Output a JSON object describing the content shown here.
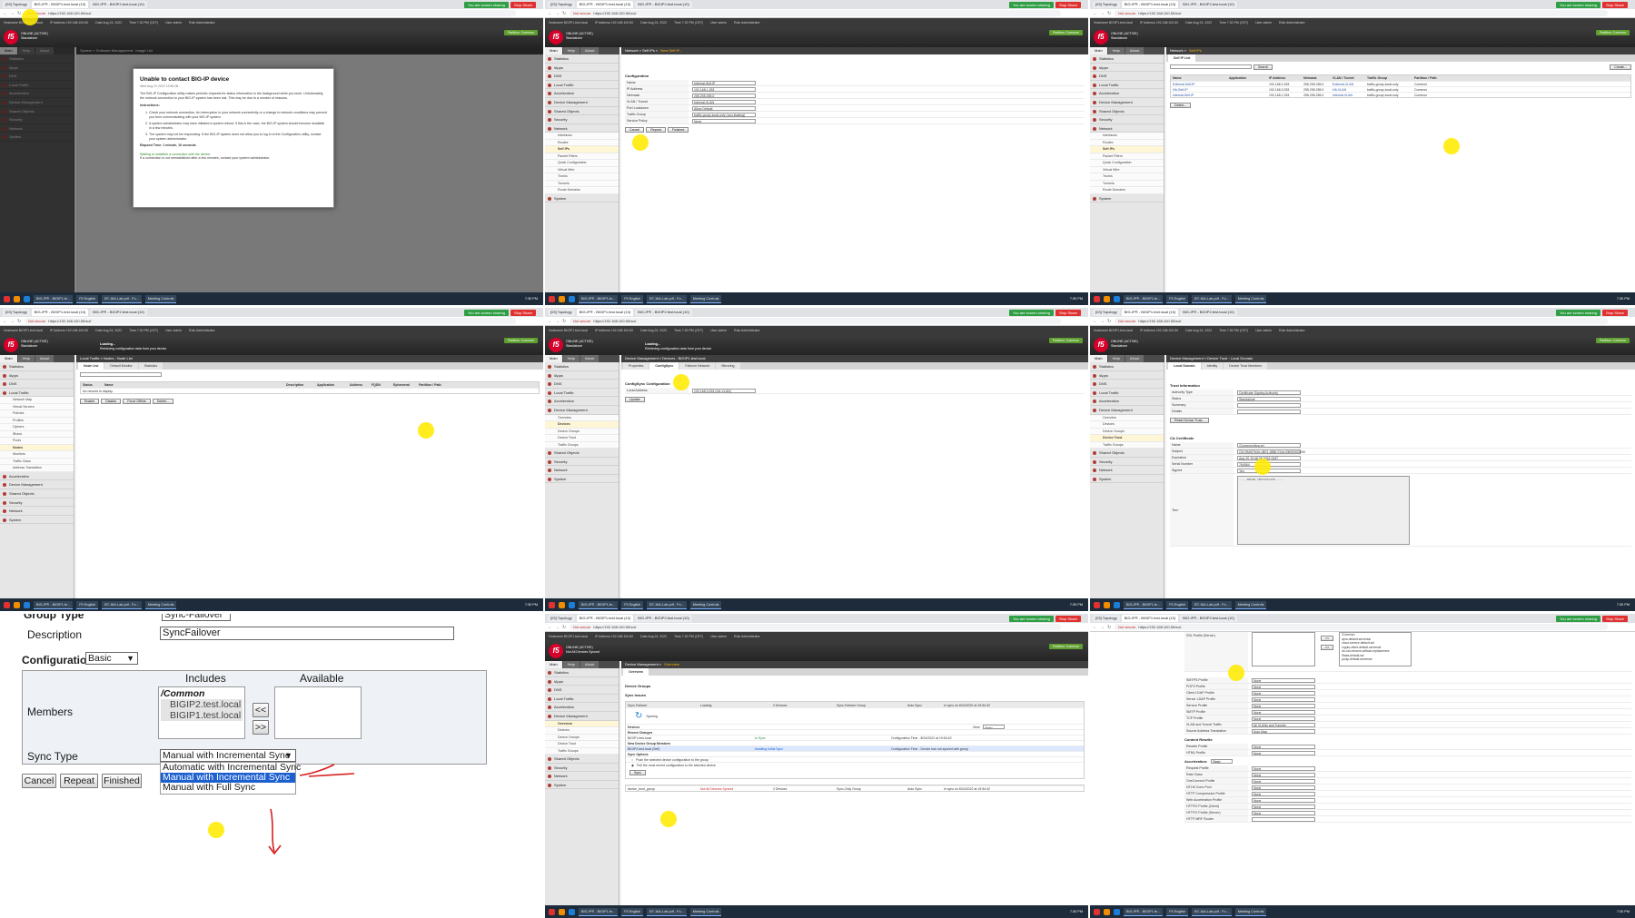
{
  "common": {
    "tabs": [
      "[03] Topology",
      "BIG-IP® - BIGIP1.test.local (10)",
      "BIG-IP® - BIGIP2.test.local (10)"
    ],
    "sharing_text": "You are screen sharing",
    "stop_share": "Stop Share",
    "not_secure": "Not secure",
    "url": "https://192.168.100.50/xui/",
    "f5_logo": "f5",
    "status_online": "ONLINE (ACTIVE)",
    "status_mode": "Standalone",
    "status_mode_sync": "Not All Devices Synced",
    "taskbar_apps": [
      "BIG-IP® - BIGIP1.te...",
      "F5 English",
      "BT-16A-Lab.pdf - Fo...",
      "Meeting Controls"
    ],
    "clock": "7:30 PM",
    "header_info": [
      "Hostname BIGIP1.test.local",
      "IP Address 192.168.100.50",
      "Date Aug 24, 2022",
      "Time 7:30 PM (CET)",
      "User admin",
      "Role Administrator"
    ],
    "partition_label": "Partition: Common",
    "log_out": "Log out",
    "nav_tabs": [
      "Main",
      "Help",
      "About"
    ],
    "nav_items": [
      "Statistics",
      "iApps",
      "DNS",
      "Local Traffic",
      "Acceleration",
      "Device Management",
      "Shared Objects",
      "Security",
      "Network",
      "System"
    ]
  },
  "panel1": {
    "breadcrumb": "System » Software Management : Image List",
    "dialog_title": "Unable to contact BIG-IP device",
    "dialog_date": "Wed Aug 24 2022 19:50:08",
    "dialog_intro": "The BIG-IP Configuration utility makes periodic requests for status information in the background while you work. Unfortunately, the network connection to your BIG-IP system has been lost. This may be due to a number of reasons.",
    "instructions_label": "Instructions:",
    "items": [
      "Check your network connection. An interruption in your network connectivity or a change to network conditions may prevent you from communicating with your BIG-IP system.",
      "A system administrator may have initiated a system reboot. If this is the case, the BIG-IP system should become available in a few minutes.",
      "The system may not be responding. If the BIG-IP system does not allow you to log in to the Configuration utility, contact your system administrator."
    ],
    "elapsed": "Elapsed Time: 1 minute, 10 seconds",
    "waiting": "Waiting to establish a connection with the device.",
    "waiting2": "If a connection is not reestablished after a few minutes, contact your system administrator."
  },
  "panel2": {
    "breadcrumb_a": "Network » Self IPs »",
    "breadcrumb_b": "New Self IP...",
    "section": "Configuration",
    "rows": [
      {
        "label": "Name",
        "value": "Internal-Self-IP"
      },
      {
        "label": "IP Address",
        "value": "192.168.1.253"
      },
      {
        "label": "Netmask",
        "value": "255.255.255.0"
      },
      {
        "label": "VLAN / Tunnel",
        "value": "Internal-VLAN"
      },
      {
        "label": "Port Lockdown",
        "value": "Allow Default"
      },
      {
        "label": "Traffic Group",
        "value": "traffic-group-local-only (non-floating)"
      },
      {
        "label": "Service Policy",
        "value": "None"
      }
    ],
    "buttons": [
      "Cancel",
      "Repeat",
      "Finished"
    ],
    "sub_items": [
      "Interfaces",
      "Routes",
      "Self IPs",
      "Packet Filters",
      "Quick Configuration",
      "Virtual Wire",
      "Trunks",
      "Tunnels",
      "Route Domains"
    ]
  },
  "panel3": {
    "breadcrumb_a": "Network »",
    "breadcrumb_b": "Self IPs",
    "subtab": "Self IP List",
    "search_btn": "Search",
    "create_btn": "Create...",
    "columns": [
      "Name",
      "Application",
      "IP Address",
      "Netmask",
      "VLAN / Tunnel",
      "Traffic Group",
      "Partition / Path"
    ],
    "rows": [
      [
        "External-Self-IP",
        "",
        "192.168.2.253",
        "255.255.255.0",
        "External-VLAN",
        "traffic-group-local-only",
        "Common"
      ],
      [
        "HA-Self-IP",
        "",
        "192.168.3.253",
        "255.255.255.0",
        "HA-VLAN",
        "traffic-group-local-only",
        "Common"
      ],
      [
        "Internal-Self-IP",
        "",
        "192.168.1.253",
        "255.255.255.0",
        "Internal-VLAN",
        "traffic-group-local-only",
        "Common"
      ]
    ],
    "delete_btn": "Delete..."
  },
  "panel4": {
    "loading": "Loading...",
    "loading_sub": "Retrieving configuration data from your device",
    "breadcrumb": "Local Traffic » Nodes : Node List",
    "subtabs": [
      "Node List",
      "Default Monitor",
      "Statistics"
    ],
    "columns": [
      "Status",
      "Name",
      "Description",
      "Application",
      "Address",
      "FQDN",
      "Ephemeral",
      "Partition / Path"
    ],
    "empty": "No records to display.",
    "buttons": [
      "Enable",
      "Disable",
      "Force Offline",
      "Delete..."
    ],
    "sub_items": [
      "Network Map",
      "Virtual Servers",
      "Policies",
      "Profiles",
      "Ciphers",
      "iRules",
      "Pools",
      "Nodes",
      "Monitors",
      "Traffic Class",
      "Address Translation"
    ]
  },
  "panel5": {
    "loading": "Loading...",
    "loading_sub": "Retrieving configuration data from your device",
    "breadcrumb": "Device Management » Devices : BIGIP1.test.local",
    "subtabs": [
      "Properties",
      "ConfigSync",
      "Failover Network",
      "Mirroring"
    ],
    "section": "ConfigSync Configuration",
    "label": "Local Address",
    "value": "192.168.3.253 (HA-VLAN)",
    "update_btn": "Update",
    "sub_items": [
      "Overview",
      "Devices",
      "Device Groups",
      "Device Trust",
      "Traffic Groups"
    ]
  },
  "panel6": {
    "breadcrumb": "Device Management » Device Trust : Local Domain",
    "subtabs": [
      "Local Domain",
      "Identity",
      "Device Trust Members"
    ],
    "section1": "Trust Information",
    "rows1": [
      {
        "label": "Authority Type",
        "value": "Certificate Signing Authority"
      },
      {
        "label": "Status",
        "value": "Standalone"
      },
      {
        "label": "Summary",
        "value": ""
      },
      {
        "label": "Details",
        "value": ""
      }
    ],
    "reset_btn": "Reset Device Trust...",
    "section2": "CA Certificate",
    "rows2": [
      {
        "label": "Name",
        "value": "/Common/dtca.crt"
      },
      {
        "label": "Subject",
        "value": "CN=9fd0f7fc2e-d501-4886-97a4-f0f000000000"
      },
      {
        "label": "Expiration",
        "value": "Aug 20 19:48:38 2032 GMT"
      },
      {
        "label": "Serial Number",
        "value": "764064"
      },
      {
        "label": "Signed",
        "value": "Yes"
      }
    ],
    "text_label": "Text",
    "cert_header": "-----BEGIN CERTIFICATE-----"
  },
  "panel7": {
    "group_type_label": "Group Type",
    "group_type_value": "Sync-Failover",
    "description_label": "Description",
    "description_value": "SyncFailover",
    "configuration_label": "Configuration:",
    "configuration_value": "Basic",
    "includes_label": "Includes",
    "available_label": "Available",
    "members_label": "Members",
    "includes_items": [
      "/Common",
      "BIGIP2.test.local",
      "BIGIP1.test.local"
    ],
    "move_left": "<<",
    "move_right": ">>",
    "sync_type_label": "Sync Type",
    "sync_type_value": "Manual with Incremental Sync",
    "sync_options": [
      "Automatic with Incremental Sync",
      "Manual with Incremental Sync",
      "Manual with Full Sync"
    ],
    "buttons": [
      "Cancel",
      "Repeat",
      "Finished"
    ]
  },
  "panel8": {
    "breadcrumb_a": "Device Management »",
    "breadcrumb_b": "Overview",
    "subtab": "Overview",
    "section": "Device Groups",
    "sync_issues": "Sync Issues",
    "group_row": [
      "Sync-Failover",
      "Loading",
      "2 Devices",
      "Sync-Failover Group",
      "Auto Sync",
      "In sync on 8/24/2022 at 19:54:42"
    ],
    "syncing": "Syncing",
    "devices_label": "Devices",
    "view_label": "View:",
    "view_value": "Basic",
    "recent_changes": "Recent Changes",
    "device1": [
      "BIGIP1.test.local",
      "In Sync",
      "Configuration Time - 8/24/2022 at 19:54:42"
    ],
    "new_members": "New Device Group Members",
    "device2": [
      "BIGIP2.test.local (Self)",
      "Awaiting Initial Sync",
      "Configuration Time - Device has not synced with group"
    ],
    "sync_options": "Sync Options",
    "opt1": "Push the selected device configuration to the group",
    "opt2": "Pull the most recent configuration to the selected device",
    "sync_btn": "Sync",
    "trust_row": [
      "device_trust_group",
      "Not All Devices Synced",
      "2 Devices",
      "Sync-Only Group",
      "Auto Sync",
      "In sync on 8/24/2022 at 19:54:42"
    ]
  },
  "panel9": {
    "ssl_server_label": "SSL Profile (Server)",
    "list_items": [
      "/Common",
      "apm-default-serverssl",
      "cloud-service-default-ssl",
      "crypto-client-default-serverssl",
      "do-not-remove-without-replacement",
      "f5aas-default-ssl",
      "pcoip-default-serverssl"
    ],
    "rows": [
      {
        "label": "SMTPS Profile",
        "value": "None"
      },
      {
        "label": "POP3 Profile",
        "value": "None"
      },
      {
        "label": "Client LDAP Profile",
        "value": "None"
      },
      {
        "label": "Server LDAP Profile",
        "value": "None"
      },
      {
        "label": "Service Profile",
        "value": "None"
      },
      {
        "label": "SMTP Profile",
        "value": "None"
      },
      {
        "label": "TCP Profile",
        "value": "None"
      },
      {
        "label": "VLAN and Tunnel Traffic",
        "value": "All VLANs and Tunnels"
      },
      {
        "label": "Source Address Translation",
        "value": "Auto Map"
      }
    ],
    "content_rewrite": "Content Rewrite",
    "rows2": [
      {
        "label": "Rewrite Profile",
        "value": "None"
      },
      {
        "label": "HTML Profile",
        "value": "None"
      }
    ],
    "acceleration": "Acceleration:",
    "acceleration_value": "Basic",
    "rows3": [
      {
        "label": "Request Profile",
        "value": "None"
      },
      {
        "label": "Rate Class",
        "value": "None"
      },
      {
        "label": "OneConnect Profile",
        "value": "None"
      },
      {
        "label": "NTLM Conn Pool",
        "value": "None"
      },
      {
        "label": "HTTP Compression Profile",
        "value": "None"
      },
      {
        "label": "Web Acceleration Profile",
        "value": "None"
      },
      {
        "label": "HTTP/2 Profile (Client)",
        "value": "None"
      },
      {
        "label": "HTTP/2 Profile (Server)",
        "value": "None"
      },
      {
        "label": "HTTP MRF Router",
        "value": ""
      }
    ]
  }
}
